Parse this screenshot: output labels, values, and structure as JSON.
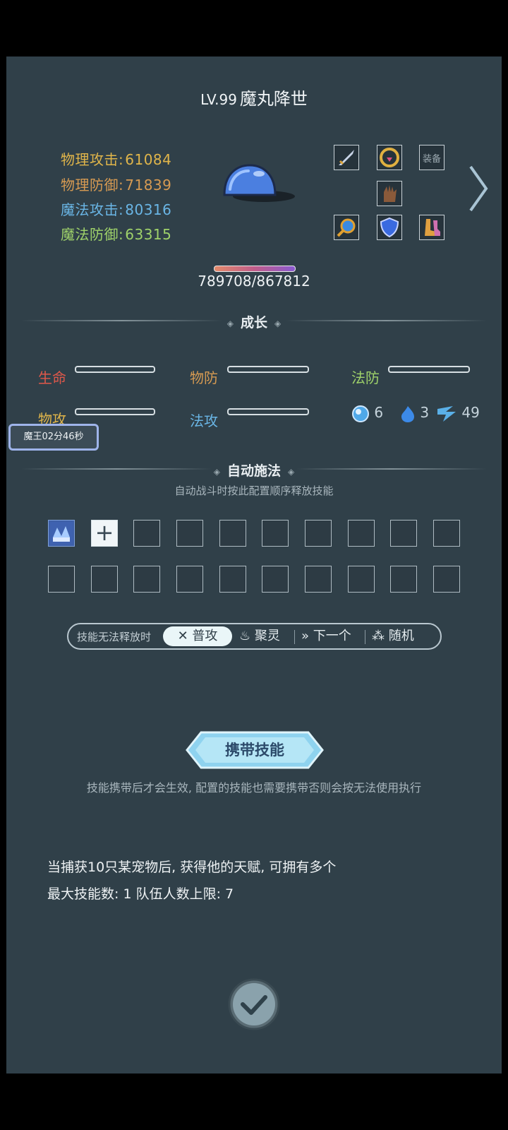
{
  "header": {
    "level": "LV.99",
    "name": "魔丸降世"
  },
  "stats": [
    {
      "label": "物理攻击:",
      "value": "61084",
      "color": "#e0b54a"
    },
    {
      "label": "物理防御:",
      "value": "71839",
      "color": "#d69a52"
    },
    {
      "label": "魔法攻击:",
      "value": "80316",
      "color": "#6ab6e6"
    },
    {
      "label": "魔法防御:",
      "value": "63315",
      "color": "#9fd26a"
    }
  ],
  "equipment": {
    "slot_labels": [
      "装备",
      "装备",
      "装备"
    ],
    "items": [
      "sword-icon",
      "amulet-icon",
      "bow-icon",
      "gauntlet-icon",
      "mirror-icon",
      "shield-icon",
      "boots-icon"
    ]
  },
  "hp": {
    "text": "789708/867812",
    "fraction": 0.91
  },
  "growth": {
    "section_title": "成长",
    "stats": [
      {
        "label": "生命",
        "color": "#e0584a"
      },
      {
        "label": "物防",
        "color": "#d69a52"
      },
      {
        "label": "法防",
        "color": "#9fd26a"
      },
      {
        "label": "物攻",
        "color": "#e0b54a"
      },
      {
        "label": "法攻",
        "color": "#6ab6e6"
      }
    ],
    "counters": [
      {
        "icon": "orb-icon",
        "value": "6"
      },
      {
        "icon": "flame-icon",
        "value": "3"
      },
      {
        "icon": "wing-icon",
        "value": "49"
      }
    ]
  },
  "timer": {
    "text": "魔王02分46秒"
  },
  "auto_cast": {
    "section_title": "自动施法",
    "subtitle": "自动战斗时按此配置顺序释放技能",
    "add_symbol": "+"
  },
  "fallback": {
    "label": "技能无法释放时",
    "options": [
      {
        "icon": "✕",
        "text": "普攻",
        "selected": true
      },
      {
        "icon": "♨",
        "text": "聚灵",
        "selected": false
      },
      {
        "icon": "»",
        "text": "下一个",
        "selected": false
      },
      {
        "icon": "⁂",
        "text": "随机",
        "selected": false
      }
    ]
  },
  "carry": {
    "button_label": "携带技能",
    "note": "技能携带后才会生效, 配置的技能也需要携带否则会按无法使用执行"
  },
  "info": {
    "line1": "当捕获10只某宠物后, 获得他的天赋, 可拥有多个",
    "line2": "最大技能数: 1   队伍人数上限: 7"
  }
}
